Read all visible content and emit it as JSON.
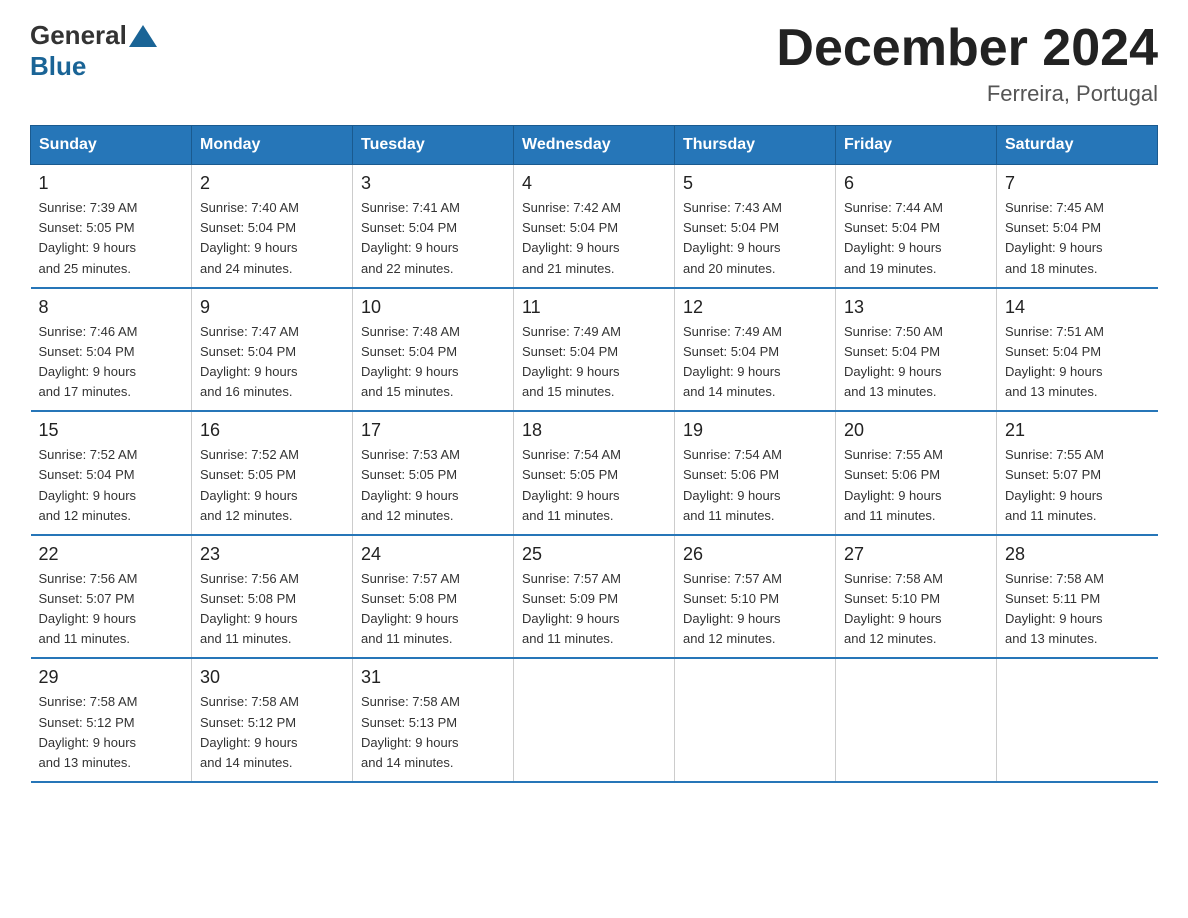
{
  "header": {
    "logo_general": "General",
    "logo_blue": "Blue",
    "main_title": "December 2024",
    "subtitle": "Ferreira, Portugal"
  },
  "days_of_week": [
    "Sunday",
    "Monday",
    "Tuesday",
    "Wednesday",
    "Thursday",
    "Friday",
    "Saturday"
  ],
  "weeks": [
    [
      {
        "day": "1",
        "sunrise": "7:39 AM",
        "sunset": "5:05 PM",
        "daylight": "9 hours and 25 minutes."
      },
      {
        "day": "2",
        "sunrise": "7:40 AM",
        "sunset": "5:04 PM",
        "daylight": "9 hours and 24 minutes."
      },
      {
        "day": "3",
        "sunrise": "7:41 AM",
        "sunset": "5:04 PM",
        "daylight": "9 hours and 22 minutes."
      },
      {
        "day": "4",
        "sunrise": "7:42 AM",
        "sunset": "5:04 PM",
        "daylight": "9 hours and 21 minutes."
      },
      {
        "day": "5",
        "sunrise": "7:43 AM",
        "sunset": "5:04 PM",
        "daylight": "9 hours and 20 minutes."
      },
      {
        "day": "6",
        "sunrise": "7:44 AM",
        "sunset": "5:04 PM",
        "daylight": "9 hours and 19 minutes."
      },
      {
        "day": "7",
        "sunrise": "7:45 AM",
        "sunset": "5:04 PM",
        "daylight": "9 hours and 18 minutes."
      }
    ],
    [
      {
        "day": "8",
        "sunrise": "7:46 AM",
        "sunset": "5:04 PM",
        "daylight": "9 hours and 17 minutes."
      },
      {
        "day": "9",
        "sunrise": "7:47 AM",
        "sunset": "5:04 PM",
        "daylight": "9 hours and 16 minutes."
      },
      {
        "day": "10",
        "sunrise": "7:48 AM",
        "sunset": "5:04 PM",
        "daylight": "9 hours and 15 minutes."
      },
      {
        "day": "11",
        "sunrise": "7:49 AM",
        "sunset": "5:04 PM",
        "daylight": "9 hours and 15 minutes."
      },
      {
        "day": "12",
        "sunrise": "7:49 AM",
        "sunset": "5:04 PM",
        "daylight": "9 hours and 14 minutes."
      },
      {
        "day": "13",
        "sunrise": "7:50 AM",
        "sunset": "5:04 PM",
        "daylight": "9 hours and 13 minutes."
      },
      {
        "day": "14",
        "sunrise": "7:51 AM",
        "sunset": "5:04 PM",
        "daylight": "9 hours and 13 minutes."
      }
    ],
    [
      {
        "day": "15",
        "sunrise": "7:52 AM",
        "sunset": "5:04 PM",
        "daylight": "9 hours and 12 minutes."
      },
      {
        "day": "16",
        "sunrise": "7:52 AM",
        "sunset": "5:05 PM",
        "daylight": "9 hours and 12 minutes."
      },
      {
        "day": "17",
        "sunrise": "7:53 AM",
        "sunset": "5:05 PM",
        "daylight": "9 hours and 12 minutes."
      },
      {
        "day": "18",
        "sunrise": "7:54 AM",
        "sunset": "5:05 PM",
        "daylight": "9 hours and 11 minutes."
      },
      {
        "day": "19",
        "sunrise": "7:54 AM",
        "sunset": "5:06 PM",
        "daylight": "9 hours and 11 minutes."
      },
      {
        "day": "20",
        "sunrise": "7:55 AM",
        "sunset": "5:06 PM",
        "daylight": "9 hours and 11 minutes."
      },
      {
        "day": "21",
        "sunrise": "7:55 AM",
        "sunset": "5:07 PM",
        "daylight": "9 hours and 11 minutes."
      }
    ],
    [
      {
        "day": "22",
        "sunrise": "7:56 AM",
        "sunset": "5:07 PM",
        "daylight": "9 hours and 11 minutes."
      },
      {
        "day": "23",
        "sunrise": "7:56 AM",
        "sunset": "5:08 PM",
        "daylight": "9 hours and 11 minutes."
      },
      {
        "day": "24",
        "sunrise": "7:57 AM",
        "sunset": "5:08 PM",
        "daylight": "9 hours and 11 minutes."
      },
      {
        "day": "25",
        "sunrise": "7:57 AM",
        "sunset": "5:09 PM",
        "daylight": "9 hours and 11 minutes."
      },
      {
        "day": "26",
        "sunrise": "7:57 AM",
        "sunset": "5:10 PM",
        "daylight": "9 hours and 12 minutes."
      },
      {
        "day": "27",
        "sunrise": "7:58 AM",
        "sunset": "5:10 PM",
        "daylight": "9 hours and 12 minutes."
      },
      {
        "day": "28",
        "sunrise": "7:58 AM",
        "sunset": "5:11 PM",
        "daylight": "9 hours and 13 minutes."
      }
    ],
    [
      {
        "day": "29",
        "sunrise": "7:58 AM",
        "sunset": "5:12 PM",
        "daylight": "9 hours and 13 minutes."
      },
      {
        "day": "30",
        "sunrise": "7:58 AM",
        "sunset": "5:12 PM",
        "daylight": "9 hours and 14 minutes."
      },
      {
        "day": "31",
        "sunrise": "7:58 AM",
        "sunset": "5:13 PM",
        "daylight": "9 hours and 14 minutes."
      },
      {
        "day": "",
        "sunrise": "",
        "sunset": "",
        "daylight": ""
      },
      {
        "day": "",
        "sunrise": "",
        "sunset": "",
        "daylight": ""
      },
      {
        "day": "",
        "sunrise": "",
        "sunset": "",
        "daylight": ""
      },
      {
        "day": "",
        "sunrise": "",
        "sunset": "",
        "daylight": ""
      }
    ]
  ]
}
